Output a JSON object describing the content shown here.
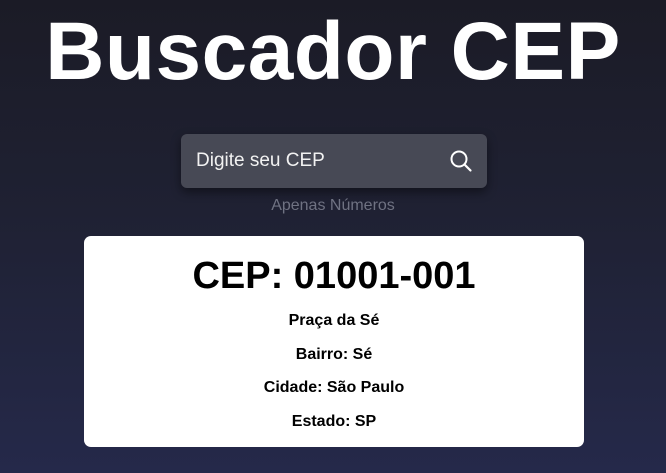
{
  "header": {
    "title": "Buscador CEP"
  },
  "search": {
    "placeholder": "Digite seu CEP",
    "value": "",
    "button_icon": "search-icon",
    "hint": "Apenas Números"
  },
  "result": {
    "cep": "CEP: 01001-001",
    "logradouro": "Praça da Sé",
    "bairro": "Bairro: Sé",
    "cidade": "Cidade: São Paulo",
    "estado": "Estado: SP"
  },
  "colors": {
    "background_top": "#1b1b26",
    "background_bottom": "#25294a",
    "search_box": "#474955",
    "hint_text": "#6f7282",
    "card": "#ffffff"
  }
}
